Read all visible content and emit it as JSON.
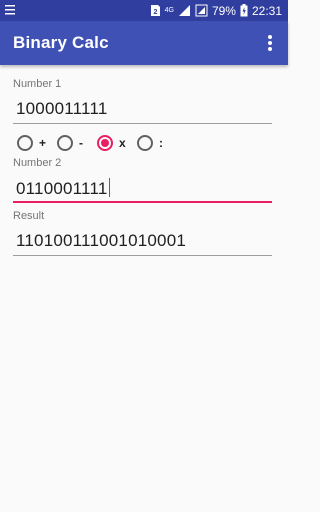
{
  "status_bar": {
    "icons": [
      "menu-lines-icon",
      "sim-icon",
      "signal-4g-icon",
      "signal-bars-icon",
      "battery-icon"
    ],
    "network_label": "4G",
    "battery": "79%",
    "time": "22:31"
  },
  "app_bar": {
    "title": "Binary Calc",
    "overflow_icon": "more-vert-icon"
  },
  "form": {
    "number1_label": "Number 1",
    "number1_value": "1000011111",
    "operations": [
      {
        "symbol": "+",
        "checked": false
      },
      {
        "symbol": "-",
        "checked": false
      },
      {
        "symbol": "x",
        "checked": true
      },
      {
        "symbol": ":",
        "checked": false
      }
    ],
    "number2_label": "Number 2",
    "number2_value": "0110001111",
    "result_label": "Result",
    "result_value": "110100111001010001"
  },
  "colors": {
    "status_bar": "#303f9f",
    "app_bar": "#3f51b5",
    "accent": "#e91e63"
  }
}
